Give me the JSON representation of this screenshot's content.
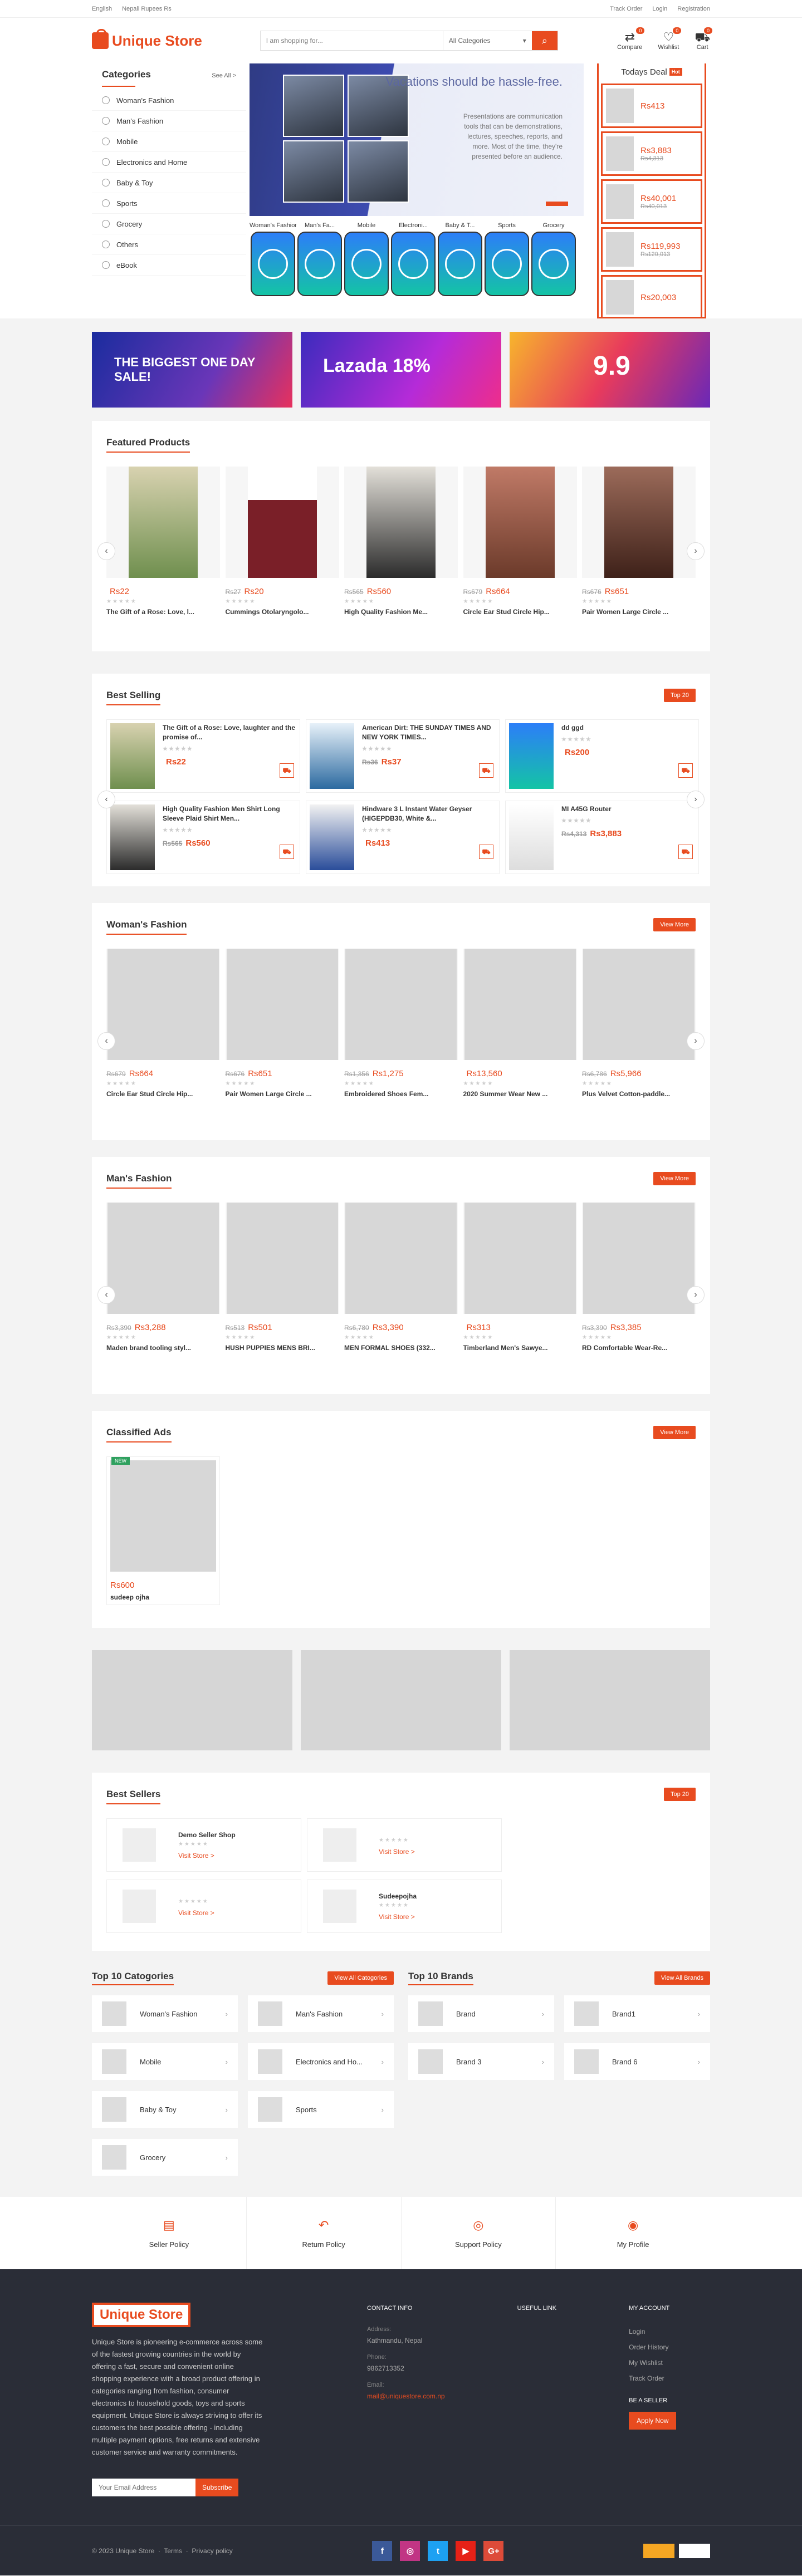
{
  "topbar": {
    "language": "English",
    "currency": "Nepali Rupees Rs",
    "track": "Track Order",
    "login": "Login",
    "register": "Registration"
  },
  "header": {
    "logo": "Unique Store",
    "search_placeholder": "I am shopping for...",
    "category": "All Categories",
    "compare": "Compare",
    "wishlist": "Wishlist",
    "cart": "Cart",
    "compare_count": "0",
    "wishlist_count": "0",
    "cart_count": "0"
  },
  "categories": {
    "title": "Categories",
    "see_all": "See All >",
    "items": [
      "Woman's Fashion",
      "Man's Fashion",
      "Mobile",
      "Electronics and Home",
      "Baby & Toy",
      "Sports",
      "Grocery",
      "Others",
      "eBook"
    ]
  },
  "slide": {
    "title": "Vacations should be hassle-free.",
    "text": "Presentations are communication tools that can be demonstrations, lectures, speeches, reports, and more. Most of the time, they're presented before an audience."
  },
  "cat_tabs": [
    "Woman's Fashion",
    "Man's Fa...",
    "Mobile",
    "Electroni...",
    "Baby & T...",
    "Sports",
    "Grocery"
  ],
  "deals": {
    "title": "Todays Deal",
    "badge": "Hot",
    "items": [
      {
        "price": "Rs413",
        "old": ""
      },
      {
        "price": "Rs3,883",
        "old": "Rs4,313"
      },
      {
        "price": "Rs40,001",
        "old": "Rs40,013"
      },
      {
        "price": "Rs119,993",
        "old": "Rs120,013"
      },
      {
        "price": "Rs20,003",
        "old": ""
      }
    ]
  },
  "banners": {
    "b1": "THE BIGGEST ONE DAY SALE!",
    "b2": "Lazada 18%",
    "b3": "9.9"
  },
  "featured": {
    "title": "Featured Products",
    "items": [
      {
        "old": "",
        "price": "Rs22",
        "name": "The Gift of a Rose: Love, l..."
      },
      {
        "old": "Rs27",
        "price": "Rs20",
        "name": "Cummings Otolaryngolo..."
      },
      {
        "old": "Rs565",
        "price": "Rs560",
        "name": "High Quality Fashion Me..."
      },
      {
        "old": "Rs679",
        "price": "Rs664",
        "name": "Circle Ear Stud Circle Hip..."
      },
      {
        "old": "Rs676",
        "price": "Rs651",
        "name": "Pair Women Large Circle ..."
      }
    ]
  },
  "best_selling": {
    "title": "Best Selling",
    "button": "Top 20",
    "items": [
      {
        "name": "The Gift of a Rose: Love, laughter and the promise of...",
        "old": "",
        "price": "Rs22"
      },
      {
        "name": "American Dirt: THE SUNDAY TIMES AND NEW YORK TIMES...",
        "old": "Rs36",
        "price": "Rs37"
      },
      {
        "name": "dd ggd",
        "old": "",
        "price": "Rs200"
      },
      {
        "name": "High Quality Fashion Men Shirt Long Sleeve Plaid Shirt Men...",
        "old": "Rs565",
        "price": "Rs560"
      },
      {
        "name": "Hindware 3 L Instant Water Geyser (HIGEPDB30, White &...",
        "old": "",
        "price": "Rs413"
      },
      {
        "name": "MI A45G Router",
        "old": "Rs4,313",
        "price": "Rs3,883"
      }
    ]
  },
  "woman": {
    "title": "Woman's Fashion",
    "button": "View More",
    "items": [
      {
        "old": "Rs679",
        "price": "Rs664",
        "name": "Circle Ear Stud Circle Hip..."
      },
      {
        "old": "Rs676",
        "price": "Rs651",
        "name": "Pair Women Large Circle ..."
      },
      {
        "old": "Rs1,356",
        "price": "Rs1,275",
        "name": "Embroidered Shoes Fem..."
      },
      {
        "old": "",
        "price": "Rs13,560",
        "name": "2020 Summer Wear New ..."
      },
      {
        "old": "Rs6,786",
        "price": "Rs5,966",
        "name": "Plus Velvet Cotton-paddle..."
      }
    ]
  },
  "man": {
    "title": "Man's Fashion",
    "button": "View More",
    "items": [
      {
        "old": "Rs3,390",
        "price": "Rs3,288",
        "name": "Maden brand tooling styl..."
      },
      {
        "old": "Rs513",
        "price": "Rs501",
        "name": "HUSH PUPPIES MENS BRI..."
      },
      {
        "old": "Rs6,780",
        "price": "Rs3,390",
        "name": "MEN FORMAL SHOES (332..."
      },
      {
        "old": "",
        "price": "Rs313",
        "name": "Timberland Men's Sawye..."
      },
      {
        "old": "Rs3,390",
        "price": "Rs3,385",
        "name": "RD Comfortable Wear-Re..."
      }
    ]
  },
  "classified": {
    "title": "Classified Ads",
    "button": "View More",
    "badge": "NEW",
    "price": "Rs600",
    "name": "sudeep ojha"
  },
  "best_sellers": {
    "title": "Best Sellers",
    "button": "Top 20",
    "items": [
      {
        "name": "Demo Seller Shop",
        "visit": "Visit Store >"
      },
      {
        "name": "",
        "visit": "Visit Store >"
      },
      {
        "name": "",
        "visit": "Visit Store >"
      },
      {
        "name": "Sudeepojha",
        "visit": "Visit Store >"
      }
    ]
  },
  "top_categories": {
    "title": "Top 10 Catogories",
    "button": "View All Catogories",
    "items": [
      "Woman's Fashion",
      "Man's Fashion",
      "Mobile",
      "Electronics and Ho...",
      "Baby & Toy",
      "Sports",
      "Grocery"
    ]
  },
  "top_brands": {
    "title": "Top 10 Brands",
    "button": "View All Brands",
    "items": [
      "Brand",
      "Brand1",
      "Brand 3",
      "Brand 6"
    ]
  },
  "policies": [
    "Seller Policy",
    "Return Policy",
    "Support Policy",
    "My Profile"
  ],
  "footer": {
    "logo": "Unique Store",
    "desc": "Unique Store is pioneering e-commerce across some of the fastest growing countries in the world by offering a fast, secure and convenient online shopping experience with a broad product offering in categories ranging from fashion, consumer electronics to household goods, toys and sports equipment. Unique Store is always striving to offer its customers the best possible offering - including multiple payment options, free returns and extensive customer service and warranty commitments.",
    "email_placeholder": "Your Email Address",
    "subscribe": "Subscribe",
    "contact_title": "CONTACT INFO",
    "address_label": "Address:",
    "address": "Kathmandu, Nepal",
    "phone_label": "Phone:",
    "phone": "9862713352",
    "email_label": "Email:",
    "email": "mail@uniquestore.com.np",
    "useful_title": "USEFUL LINK",
    "account_title": "MY ACCOUNT",
    "account_links": [
      "Login",
      "Order History",
      "My Wishlist",
      "Track Order"
    ],
    "seller_title": "BE A SELLER",
    "apply": "Apply Now",
    "copyright": "© 2023 Unique Store",
    "terms": "Terms",
    "privacy": "Privacy policy"
  }
}
